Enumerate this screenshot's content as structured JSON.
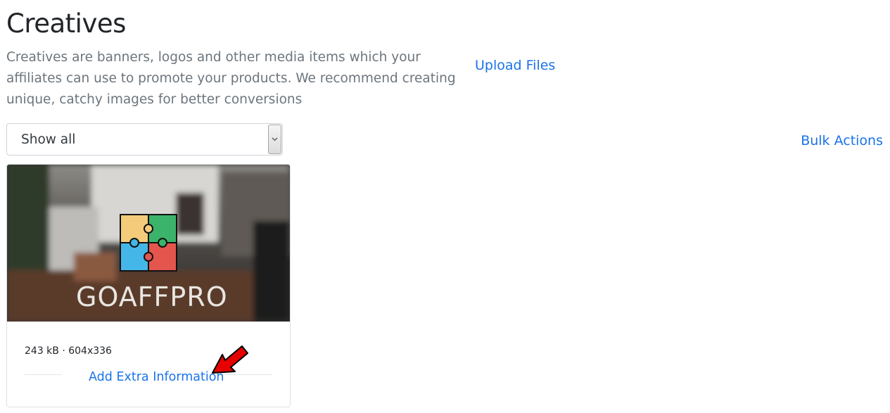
{
  "page": {
    "title": "Creatives",
    "description": "Creatives are banners, logos and other media items which your affiliates can use to promote your products. We recommend creating unique, catchy images for better conversions"
  },
  "actions": {
    "upload_label": "Upload Files",
    "bulk_label": "Bulk Actions"
  },
  "filter": {
    "selected": "Show all"
  },
  "creatives": [
    {
      "brand_text": "GOAFFPRO",
      "meta": "243 kB · 604x336",
      "extra_link": "Add Extra Information"
    }
  ],
  "colors": {
    "link": "#1a73e8",
    "annotation_arrow": "#e60000"
  },
  "icons": {
    "select_arrow": "chevron-down-icon",
    "annotation": "red-arrow-icon",
    "logo": "puzzle-logo-icon"
  }
}
